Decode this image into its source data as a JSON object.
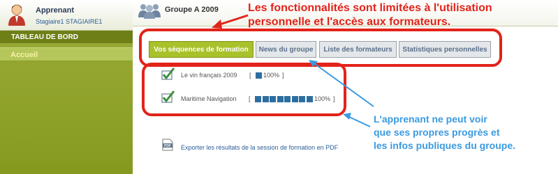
{
  "user": {
    "role": "Apprenant",
    "name": "Stagiaire1 STAGIAIRE1"
  },
  "sidebar": {
    "title": "TABLEAU DE BORD",
    "items": [
      {
        "label": "Accueil",
        "active": true
      }
    ]
  },
  "header": {
    "group": "Groupe A 2009"
  },
  "tabs": [
    {
      "label": "Vos séquences de formation",
      "active": true
    },
    {
      "label": "News du groupe"
    },
    {
      "label": "Liste des formateurs"
    },
    {
      "label": "Statistiques personnelles"
    }
  ],
  "courses": [
    {
      "name": "Le vin français 2009",
      "open": "[",
      "percent": "100%",
      "close": "]",
      "progress": 1.0
    },
    {
      "name": "Maritime Navigation",
      "open": "[",
      "percent": "100%",
      "close": "]",
      "progress": 1.0
    }
  ],
  "export": {
    "label": "Exporter les résultats de la session de formation en PDF"
  },
  "annotations": {
    "top": [
      "Les fonctionnalités sont limitées à l'utilisation",
      "personnelle et l'accès aux formateurs."
    ],
    "bottom": [
      "L'apprenant ne peut voir",
      "que ses propres progrès et",
      "les infos publiques du groupe."
    ]
  },
  "colors": {
    "accent": "#a9c12a",
    "sidebar": "#8fa22a",
    "annotation_red": "#e2231a",
    "annotation_blue": "#3b9ae0",
    "progress": "#2d6ea0"
  },
  "icons": {
    "avatar": "user-avatar-icon",
    "group": "group-users-icon",
    "check": "course-check-icon",
    "pdf": "pdf-icon"
  }
}
